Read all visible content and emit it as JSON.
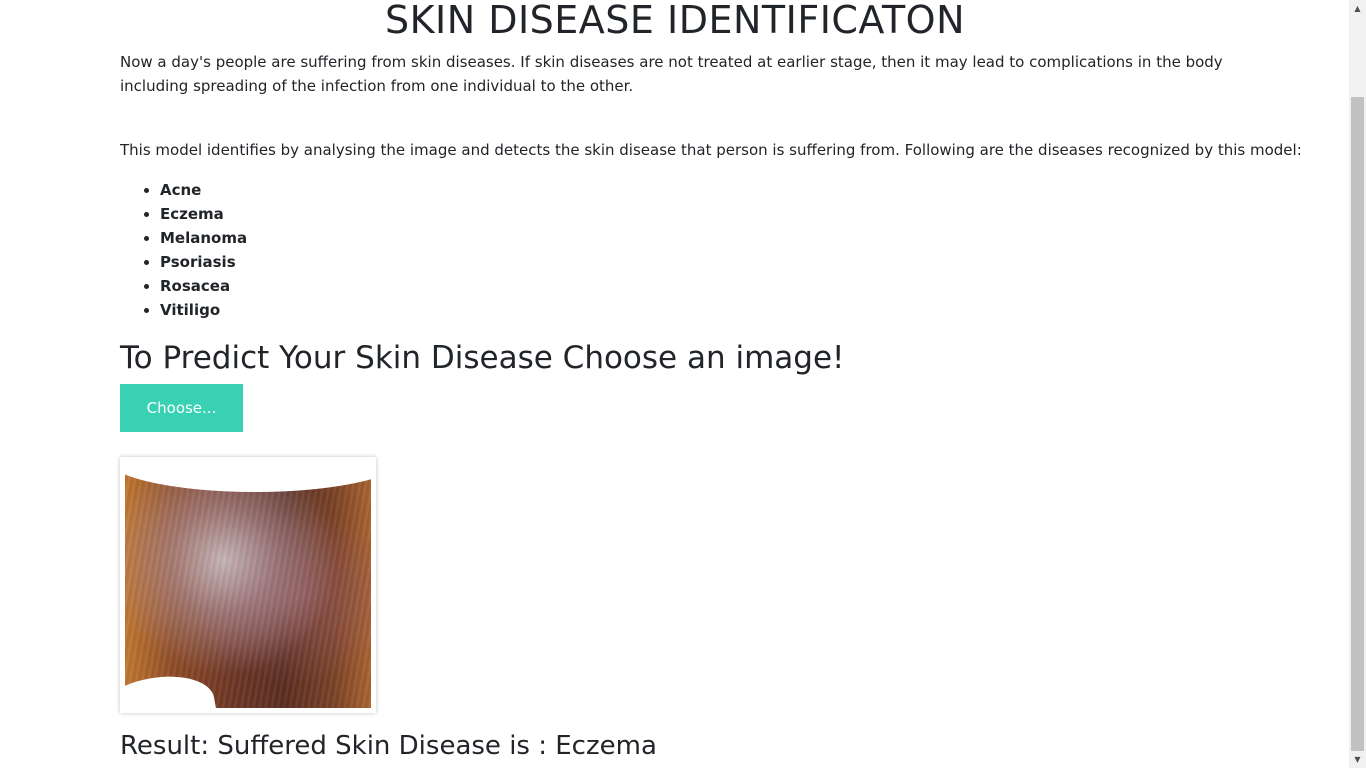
{
  "header": {
    "title": "SKIN DISEASE IDENTIFICATON"
  },
  "intro": {
    "paragraph1": "Now a day's people are suffering from skin diseases. If skin diseases are not treated at earlier stage, then it may lead to complications in the body including spreading of the infection from one individual to the other.",
    "paragraph2": "This model identifies by analysing the image and detects the skin disease that person is suffering from. Following are the diseases recognized by this model:"
  },
  "diseases": [
    "Acne",
    "Eczema",
    "Melanoma",
    "Psoriasis",
    "Rosacea",
    "Vitiligo"
  ],
  "upload": {
    "heading": "To Predict Your Skin Disease Choose an image!",
    "button_label": "Choose..."
  },
  "result": {
    "text": "Result: Suffered Skin Disease is : Eczema"
  },
  "colors": {
    "accent": "#39d1b4",
    "text": "#212529"
  },
  "icons": {
    "scroll_up": "triangle-up-icon",
    "scroll_down": "triangle-down-icon"
  }
}
